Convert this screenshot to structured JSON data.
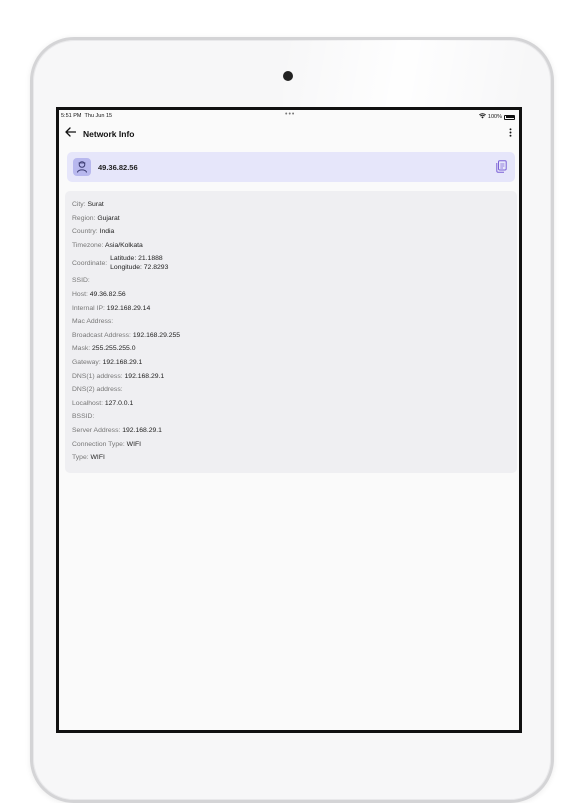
{
  "status": {
    "time": "5:51 PM",
    "date": "Thu Jun 15",
    "battery": "100%"
  },
  "header": {
    "title": "Network Info"
  },
  "ip_card": {
    "ip": "49.36.82.56"
  },
  "info": {
    "city": {
      "label": "City:",
      "value": "Surat"
    },
    "region": {
      "label": "Region:",
      "value": "Gujarat"
    },
    "country": {
      "label": "Country:",
      "value": "India"
    },
    "timezone": {
      "label": "Timezone:",
      "value": "Asia/Kolkata"
    },
    "coordinate": {
      "label": "Coordinate:",
      "latitude": "Latitude: 21.1888",
      "longitude": "Longitude: 72.8293"
    },
    "ssid": {
      "label": "SSID:",
      "value": ""
    },
    "host": {
      "label": "Host:",
      "value": "49.36.82.56"
    },
    "internal_ip": {
      "label": "Internal IP:",
      "value": "192.168.29.14"
    },
    "mac": {
      "label": "Mac Address:",
      "value": ""
    },
    "broadcast": {
      "label": "Broadcast Address:",
      "value": "192.168.29.255"
    },
    "mask": {
      "label": "Mask:",
      "value": "255.255.255.0"
    },
    "gateway": {
      "label": "Gateway:",
      "value": "192.168.29.1"
    },
    "dns1": {
      "label": "DNS(1) address:",
      "value": "192.168.29.1"
    },
    "dns2": {
      "label": "DNS(2) address:",
      "value": ""
    },
    "localhost": {
      "label": "Localhost:",
      "value": "127.0.0.1"
    },
    "bssid": {
      "label": "BSSID:",
      "value": ""
    },
    "server": {
      "label": "Server Address:",
      "value": "192.168.29.1"
    },
    "connection_type": {
      "label": "Connection Type:",
      "value": "WIFI"
    },
    "type": {
      "label": "Type:",
      "value": "WIFI"
    }
  },
  "icons": {
    "back": "arrow-left-icon",
    "more": "more-vertical-icon",
    "avatar": "ip-person-icon",
    "copy": "copy-icon"
  },
  "colors": {
    "ip_card_bg": "#e6e6fa",
    "accent": "#7b61d6",
    "info_card_bg": "#efeff2"
  }
}
